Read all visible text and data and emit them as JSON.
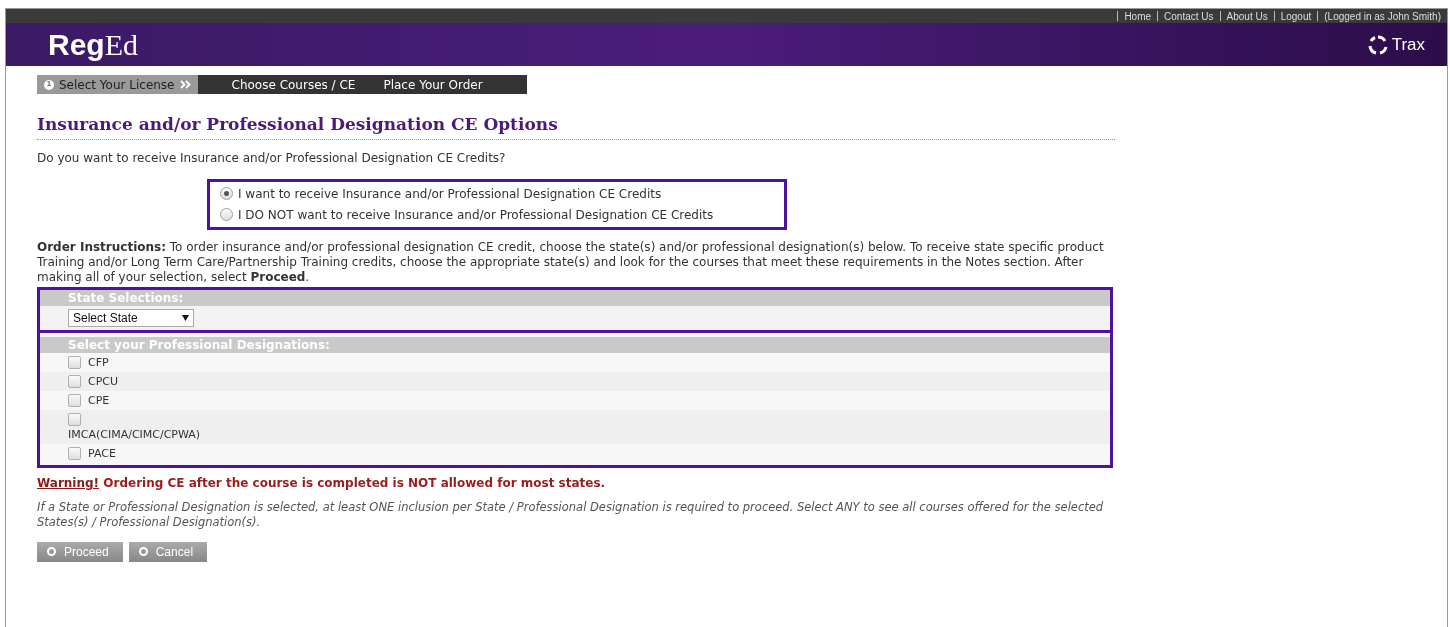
{
  "top_links": [
    "Home",
    "Contact Us",
    "About Us",
    "Logout",
    "(Logged in as John Smith)"
  ],
  "header": {
    "logo_bold": "Reg",
    "logo_light": "Ed",
    "brand": "Trax"
  },
  "steps": [
    {
      "number": "1",
      "label": "Select Your License",
      "selected": true
    },
    {
      "label": "Choose Courses / CE",
      "selected": false
    },
    {
      "label": "Place Your Order",
      "selected": false
    }
  ],
  "title": "Insurance and/or Professional Designation CE Options",
  "question": "Do you want to receive Insurance and/or Professional Designation CE Credits?",
  "radios": [
    {
      "label": "I want to receive Insurance and/or Professional Designation CE Credits",
      "selected": true
    },
    {
      "label": "I DO NOT want to receive Insurance and/or Professional Designation CE Credits",
      "selected": false
    }
  ],
  "instructions": "**Order Instructions:** To order insurance and/or professional designation CE credit, choose the state(s) and/or professional designation(s) below. To receive state specific product Training and/or Long Term Care/Partnership Training credits, choose the appropriate state(s) and look for the courses that meet these requirements in the Notes section. After making all of your selection, select **Proceed**.",
  "state_section": {
    "heading": "State Selections:",
    "select_value": "Select State"
  },
  "designations": {
    "heading": "Select your Professional Designations:",
    "items": [
      {
        "label": "CFP",
        "checked": false
      },
      {
        "label": "CPCU",
        "checked": false
      },
      {
        "label": "CPE",
        "checked": false
      },
      {
        "label": "IMCA(CIMA/CIMC/CPWA)",
        "checked": false,
        "wrapped": true
      },
      {
        "label": "PACE",
        "checked": false
      }
    ]
  },
  "warning": {
    "label": "Warning!",
    "message": "Ordering CE after the course is completed is NOT allowed for most states."
  },
  "note": "If a State or Professional Designation is selected, at least ONE inclusion per State / Professional Designation is required to proceed. Select ANY to see all courses offered for the selected States(s) / Professional Designation(s).",
  "buttons": [
    "Proceed",
    "Cancel"
  ]
}
